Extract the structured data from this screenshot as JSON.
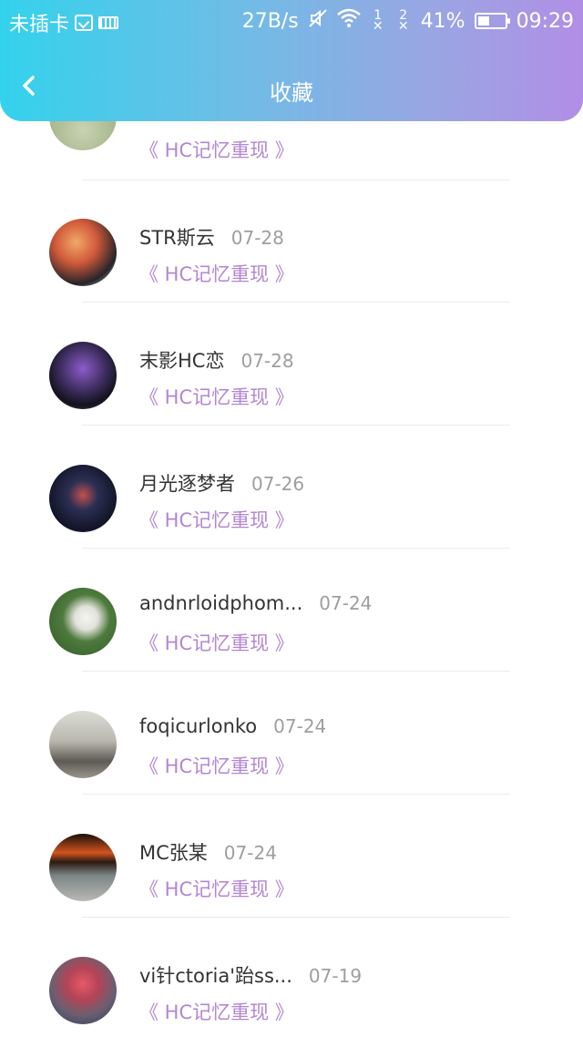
{
  "status_bar": {
    "carrier": "未插卡",
    "speed": "27B/s",
    "sim1": "1",
    "sim2": "2",
    "battery": "41%",
    "time": "09:29"
  },
  "app_bar": {
    "title": "收藏"
  },
  "items": [
    {
      "name": "",
      "date": "",
      "work": "《 HC记忆重现 》"
    },
    {
      "name": "STR斯云",
      "date": "07-28",
      "work": "《 HC记忆重现 》"
    },
    {
      "name": "末影HC恋",
      "date": "07-28",
      "work": "《 HC记忆重现 》"
    },
    {
      "name": "月光逐梦者",
      "date": "07-26",
      "work": "《 HC记忆重现 》"
    },
    {
      "name": "andnrloidphom...",
      "date": "07-24",
      "work": "《 HC记忆重现 》"
    },
    {
      "name": "foqicurlonko",
      "date": "07-24",
      "work": "《 HC记忆重现 》"
    },
    {
      "name": "MC张某",
      "date": "07-24",
      "work": "《 HC记忆重现 》"
    },
    {
      "name": "vi针ctoria'跆ss...",
      "date": "07-19",
      "work": "《 HC记忆重现 》"
    }
  ]
}
